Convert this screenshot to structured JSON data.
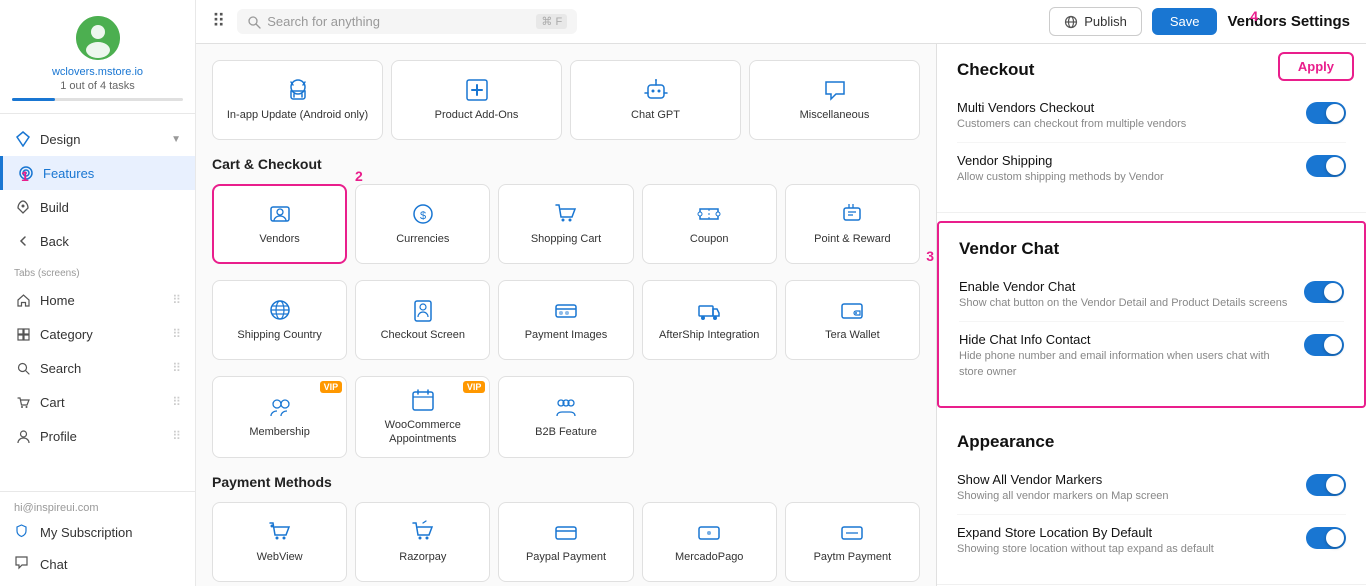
{
  "sidebar": {
    "site_url": "wclovers.mstore.io",
    "tasks": "1 out of 4 tasks",
    "email": "hi@inspireui.com",
    "nav_items": [
      {
        "label": "Design",
        "icon": "diamond",
        "has_chevron": true,
        "active": false
      },
      {
        "label": "Features",
        "icon": "target",
        "has_chevron": false,
        "active": true
      },
      {
        "label": "Build",
        "icon": "rocket",
        "has_chevron": false,
        "active": false
      },
      {
        "label": "Back",
        "icon": "arrow-left",
        "has_chevron": false,
        "active": false
      }
    ],
    "tabs_label": "Tabs (screens)",
    "tab_items": [
      {
        "label": "Home",
        "icon": "home"
      },
      {
        "label": "Category",
        "icon": "grid"
      },
      {
        "label": "Search",
        "icon": "search"
      },
      {
        "label": "Cart",
        "icon": "cart"
      },
      {
        "label": "Profile",
        "icon": "person"
      }
    ],
    "bottom_items": [
      {
        "label": "My Subscription",
        "icon": "shield"
      },
      {
        "label": "Chat",
        "icon": "chat"
      }
    ]
  },
  "topbar": {
    "search_placeholder": "Search for anything",
    "search_shortcut": "⌘ F",
    "publish_label": "Publish",
    "save_label": "Save",
    "title": "Vendors Settings"
  },
  "features": {
    "top_cards": [
      {
        "label": "In-app Update (Android only)",
        "icon": "android",
        "vip": false
      },
      {
        "label": "Product Add-Ons",
        "icon": "plus-box",
        "vip": false
      },
      {
        "label": "Chat GPT",
        "icon": "robot",
        "vip": false
      },
      {
        "label": "Miscellaneous",
        "icon": "chat-bubble",
        "vip": false
      }
    ],
    "cart_checkout_title": "Cart & Checkout",
    "cart_cards": [
      {
        "label": "Vendors",
        "icon": "person-card",
        "vip": false,
        "selected": true
      },
      {
        "label": "Currencies",
        "icon": "dollar",
        "vip": false
      },
      {
        "label": "Shopping Cart",
        "icon": "cart",
        "vip": false
      },
      {
        "label": "Coupon",
        "icon": "tag",
        "vip": false
      },
      {
        "label": "Point & Reward",
        "icon": "briefcase",
        "vip": false
      }
    ],
    "cart_cards_row2": [
      {
        "label": "Shipping Country",
        "icon": "globe",
        "vip": false
      },
      {
        "label": "Checkout Screen",
        "icon": "person-screen",
        "vip": false
      },
      {
        "label": "Payment Images",
        "icon": "credit-card-img",
        "vip": false
      },
      {
        "label": "AfterShip Integration",
        "icon": "ship",
        "vip": false
      },
      {
        "label": "Tera Wallet",
        "icon": "wallet-t",
        "vip": false
      }
    ],
    "cart_cards_row3": [
      {
        "label": "Membership",
        "icon": "people",
        "vip": true
      },
      {
        "label": "WooCommerce Appointments",
        "icon": "calendar",
        "vip": true
      },
      {
        "label": "B2B Feature",
        "icon": "people3",
        "vip": false
      },
      {
        "label": "",
        "icon": "",
        "vip": false
      },
      {
        "label": "",
        "icon": "",
        "vip": false
      }
    ],
    "payment_title": "Payment Methods",
    "payment_cards": [
      {
        "label": "WebView",
        "icon": "cart-w"
      },
      {
        "label": "Razorpay",
        "icon": "cart-r"
      },
      {
        "label": "Paypal Payment",
        "icon": "pp"
      },
      {
        "label": "MercadoPago",
        "icon": "mp"
      },
      {
        "label": "Paytm Payment",
        "icon": "paytm"
      }
    ]
  },
  "right_panel": {
    "checkout_title": "Checkout",
    "settings": [
      {
        "name": "Multi Vendors Checkout",
        "desc": "Customers can checkout from multiple vendors",
        "enabled": true
      },
      {
        "name": "Vendor Shipping",
        "desc": "Allow custom shipping methods by Vendor",
        "enabled": true
      }
    ],
    "vendor_chat_title": "Vendor Chat",
    "vendor_chat_settings": [
      {
        "name": "Enable Vendor Chat",
        "desc": "Show chat button on the Vendor Detail and Product Details screens",
        "enabled": true
      },
      {
        "name": "Hide Chat Info Contact",
        "desc": "Hide phone number and email information when users chat with store owner",
        "enabled": true
      }
    ],
    "appearance_title": "Appearance",
    "appearance_settings": [
      {
        "name": "Show All Vendor Markers",
        "desc": "Showing all vendor markers on Map screen",
        "enabled": true
      },
      {
        "name": "Expand Store Location By Default",
        "desc": "Showing store location without tap expand as default",
        "enabled": true
      }
    ]
  },
  "badges": {
    "b1": "1",
    "b2": "2",
    "b3": "3",
    "b4": "4"
  },
  "apply_label": "Apply"
}
